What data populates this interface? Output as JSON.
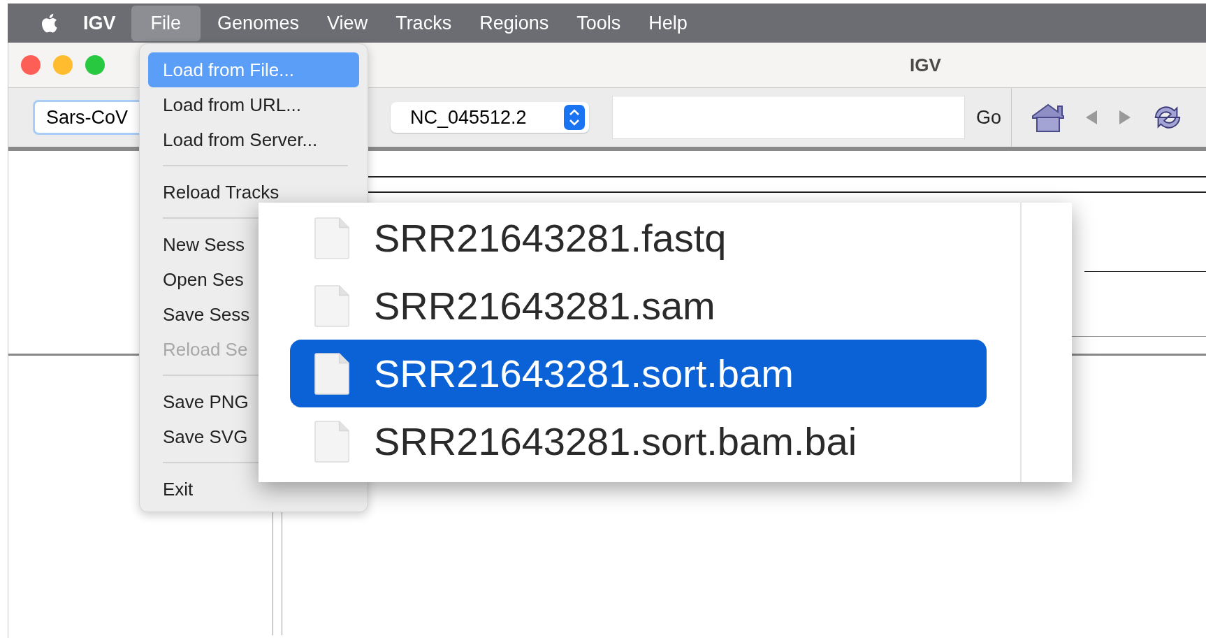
{
  "menubar": {
    "items": [
      {
        "label": "IGV",
        "selected": false
      },
      {
        "label": "File",
        "selected": true
      },
      {
        "label": "Genomes",
        "selected": false
      },
      {
        "label": "View",
        "selected": false
      },
      {
        "label": "Tracks",
        "selected": false
      },
      {
        "label": "Regions",
        "selected": false
      },
      {
        "label": "Tools",
        "selected": false
      },
      {
        "label": "Help",
        "selected": false
      }
    ]
  },
  "window": {
    "title": "IGV"
  },
  "toolbar": {
    "genome": "Sars-CoV",
    "chromosome": "NC_045512.2",
    "go_button": "Go"
  },
  "file_menu": {
    "items": [
      {
        "kind": "item",
        "label": "Load from File...",
        "selected": true,
        "disabled": false
      },
      {
        "kind": "item",
        "label": "Load from URL...",
        "selected": false,
        "disabled": false
      },
      {
        "kind": "item",
        "label": "Load from Server...",
        "selected": false,
        "disabled": false
      },
      {
        "kind": "separator"
      },
      {
        "kind": "item",
        "label": "Reload Tracks",
        "selected": false,
        "disabled": false
      },
      {
        "kind": "separator"
      },
      {
        "kind": "item",
        "label": "New Sess",
        "selected": false,
        "disabled": false
      },
      {
        "kind": "item",
        "label": "Open Ses",
        "selected": false,
        "disabled": false
      },
      {
        "kind": "item",
        "label": "Save Sess",
        "selected": false,
        "disabled": false
      },
      {
        "kind": "item",
        "label": "Reload Se",
        "selected": false,
        "disabled": true
      },
      {
        "kind": "separator"
      },
      {
        "kind": "item",
        "label": "Save PNG",
        "selected": false,
        "disabled": false
      },
      {
        "kind": "item",
        "label": "Save SVG",
        "selected": false,
        "disabled": false
      },
      {
        "kind": "separator"
      },
      {
        "kind": "item",
        "label": "Exit",
        "selected": false,
        "disabled": false
      }
    ]
  },
  "file_list": {
    "files": [
      {
        "name": "SRR21643281.fastq",
        "selected": false
      },
      {
        "name": "SRR21643281.sam",
        "selected": false
      },
      {
        "name": "SRR21643281.sort.bam",
        "selected": true
      },
      {
        "name": "SRR21643281.sort.bam.bai",
        "selected": false
      }
    ]
  }
}
